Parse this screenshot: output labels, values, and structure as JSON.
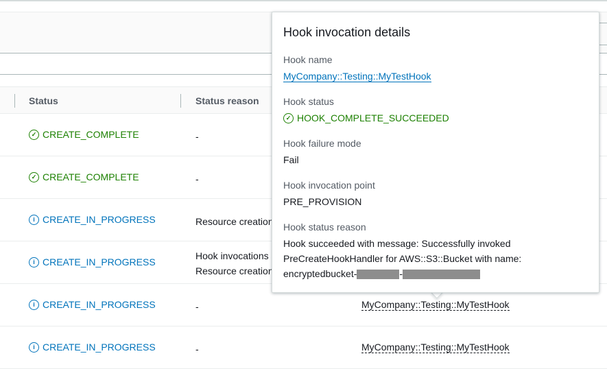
{
  "table": {
    "columns": [
      "Status",
      "Status reason"
    ],
    "rows": [
      {
        "status": "CREATE_COMPLETE",
        "kind": "ok",
        "reason": [
          "-"
        ],
        "hook": ""
      },
      {
        "status": "CREATE_COMPLETE",
        "kind": "ok",
        "reason": [
          "-"
        ],
        "hook": ""
      },
      {
        "status": "CREATE_IN_PROGRESS",
        "kind": "info",
        "reason": [
          "Resource creation"
        ],
        "hook": ""
      },
      {
        "status": "CREATE_IN_PROGRESS",
        "kind": "info",
        "reason": [
          "Hook invocations",
          "Resource creation"
        ],
        "hook": ""
      },
      {
        "status": "CREATE_IN_PROGRESS",
        "kind": "info",
        "reason": [
          "-"
        ],
        "hook": "MyCompany::Testing::MyTestHook"
      },
      {
        "status": "CREATE_IN_PROGRESS",
        "kind": "info",
        "reason": [
          "-"
        ],
        "hook": "MyCompany::Testing::MyTestHook"
      }
    ]
  },
  "popover": {
    "title": "Hook invocation details",
    "hook_name_label": "Hook name",
    "hook_name": "MyCompany::Testing::MyTestHook",
    "hook_status_label": "Hook status",
    "hook_status": "HOOK_COMPLETE_SUCCEEDED",
    "failure_mode_label": "Hook failure mode",
    "failure_mode": "Fail",
    "invocation_point_label": "Hook invocation point",
    "invocation_point": "PRE_PROVISION",
    "status_reason_label": "Hook status reason",
    "status_reason_line1": "Hook succeeded with message: Successfully invoked",
    "status_reason_line2": "PreCreateHookHandler for AWS::S3::Bucket with name:",
    "status_reason_line3": "encryptedbucket-"
  },
  "colors": {
    "success": "#1d8102",
    "info": "#0073bb"
  }
}
